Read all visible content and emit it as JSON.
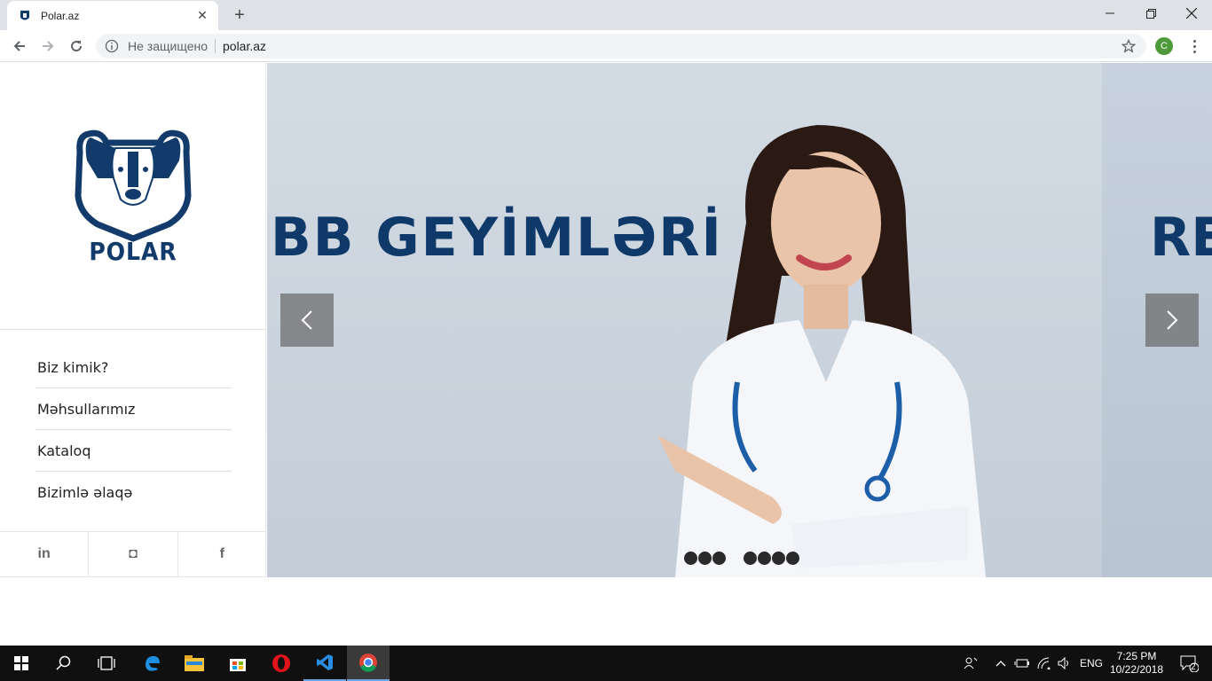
{
  "browser": {
    "tab_title": "Polar.az",
    "tab_close": "✕",
    "new_tab": "+",
    "security_label": "Не защищено",
    "url": "polar.az",
    "profile_initial": "C"
  },
  "brand": {
    "logo_text": "POLAR",
    "navy": "#123a6b"
  },
  "sidebar": {
    "nav": [
      {
        "label": "Biz kimik?"
      },
      {
        "label": "Məhsullarımız"
      },
      {
        "label": "Kataloq"
      },
      {
        "label": "Bizimlə əlaqə"
      }
    ],
    "social": [
      {
        "label": "in",
        "icon": "linkedin-icon"
      },
      {
        "label": "◘",
        "icon": "instagram-icon"
      },
      {
        "label": "f",
        "icon": "facebook-icon"
      }
    ]
  },
  "slider": {
    "headline": "BB GEYİMLƏRİ",
    "next_headline_partial": "RE",
    "dots_group1": 3,
    "dots_group2": 4
  },
  "taskbar": {
    "language": "ENG",
    "time": "7:25 PM",
    "date": "10/22/2018",
    "notifications": "2"
  }
}
